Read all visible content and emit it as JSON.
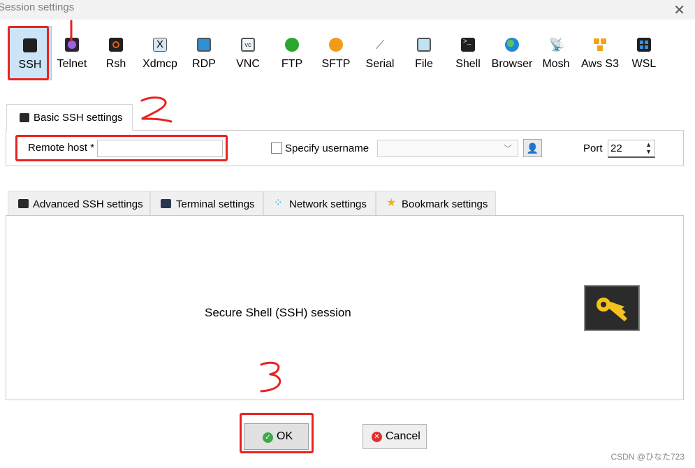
{
  "window": {
    "title": "Session settings"
  },
  "session_types": [
    {
      "label": "SSH",
      "icon": "ssh-key-icon",
      "color": "#2a2a2a"
    },
    {
      "label": "Telnet",
      "icon": "telnet-icon",
      "color": "#7b4fd0"
    },
    {
      "label": "Rsh",
      "icon": "rsh-icon",
      "color": "#e0621a"
    },
    {
      "label": "Xdmcp",
      "icon": "xdmcp-icon",
      "color": "#3b74c9"
    },
    {
      "label": "RDP",
      "icon": "rdp-icon",
      "color": "#2d8fd8"
    },
    {
      "label": "VNC",
      "icon": "vnc-icon",
      "color": "#4aa7d9"
    },
    {
      "label": "FTP",
      "icon": "ftp-icon",
      "color": "#2aa52e"
    },
    {
      "label": "SFTP",
      "icon": "sftp-icon",
      "color": "#f29a1a"
    },
    {
      "label": "Serial",
      "icon": "serial-icon",
      "color": "#8b8b8b"
    },
    {
      "label": "File",
      "icon": "file-icon",
      "color": "#4aa7d9"
    },
    {
      "label": "Shell",
      "icon": "shell-icon",
      "color": "#222222"
    },
    {
      "label": "Browser",
      "icon": "browser-icon",
      "color": "#1e88d4"
    },
    {
      "label": "Mosh",
      "icon": "mosh-icon",
      "color": "#4aa7d9"
    },
    {
      "label": "Aws S3",
      "icon": "aws-s3-icon",
      "color": "#f2a51a"
    },
    {
      "label": "WSL",
      "icon": "wsl-icon",
      "color": "#1f5fb8"
    }
  ],
  "basic": {
    "tab_label": "Basic SSH settings",
    "remote_host_label": "Remote host *",
    "remote_host_value": "",
    "specify_username_label": "Specify username",
    "specify_username_checked": false,
    "username_value": "",
    "port_label": "Port",
    "port_value": "22"
  },
  "subtabs": [
    {
      "label": "Advanced SSH settings",
      "icon": "ssh-key-icon"
    },
    {
      "label": "Terminal settings",
      "icon": "terminal-icon"
    },
    {
      "label": "Network settings",
      "icon": "network-icon"
    },
    {
      "label": "Bookmark settings",
      "icon": "star-icon"
    }
  ],
  "content": {
    "session_label": "Secure Shell (SSH) session"
  },
  "buttons": {
    "ok": "OK",
    "cancel": "Cancel"
  },
  "watermark": "CSDN @ひなた723",
  "annotations": {
    "step1": "1",
    "step2": "2",
    "step3": "3",
    "color": "#e8231f"
  }
}
